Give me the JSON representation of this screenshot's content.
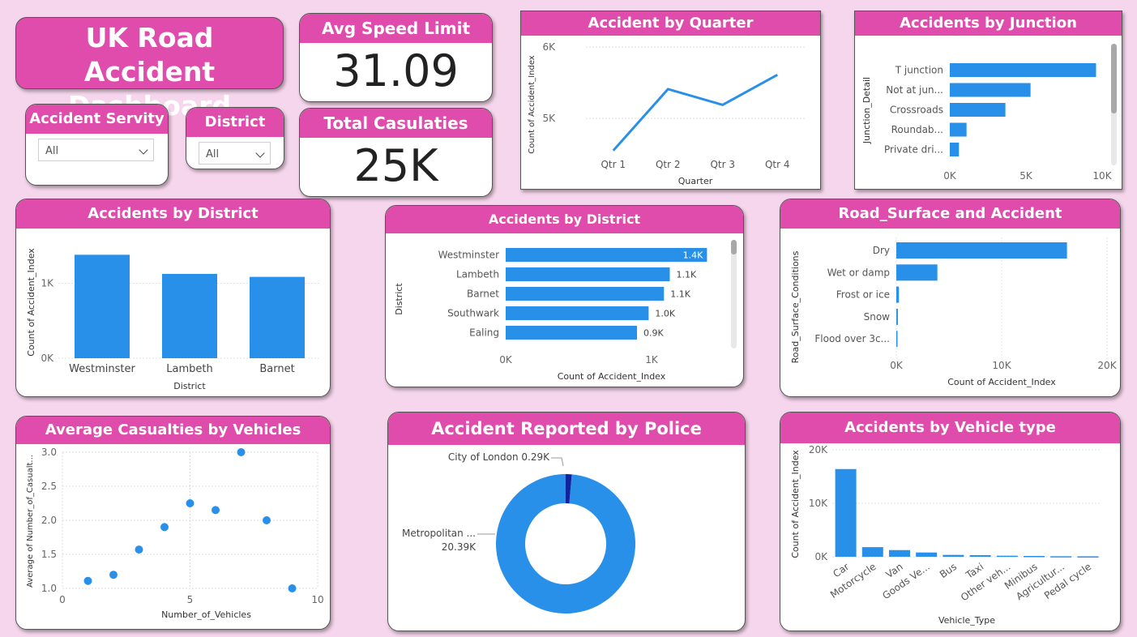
{
  "colors": {
    "accent": "#e04cac",
    "bar": "#2990ea",
    "dark_slice": "#12239e",
    "background": "#f6d6ec"
  },
  "dashboard_title": "UK Road Accident Dashboard",
  "kpis": {
    "speed": {
      "title": "Avg Speed Limit",
      "value": "31.09"
    },
    "casualties": {
      "title": "Total Casulaties",
      "value": "25K"
    }
  },
  "slicers": {
    "severity": {
      "title": "Accident Servity",
      "value": "All"
    },
    "district": {
      "title": "District",
      "value": "All"
    }
  },
  "chart_data": [
    {
      "id": "quarter",
      "type": "line",
      "title": "Accident by Quarter",
      "xlabel": "Quarter",
      "ylabel": "Count of Accident_Index",
      "categories": [
        "Qtr 1",
        "Qtr 2",
        "Qtr 3",
        "Qtr 4"
      ],
      "values": [
        4550,
        5410,
        5190,
        5610
      ],
      "ylim": [
        4400,
        6000
      ],
      "yticks": [
        {
          "v": 5000,
          "label": "5K"
        },
        {
          "v": 6000,
          "label": "6K"
        }
      ],
      "grid": true
    },
    {
      "id": "junction",
      "type": "bar",
      "orientation": "horizontal",
      "title": "Accidents by Junction",
      "xlabel": "Count of Accident_Index",
      "ylabel": "Junction_Detail",
      "categories": [
        "T junction",
        "Not at jun...",
        "Crossroads",
        "Roundab...",
        "Private dri..."
      ],
      "values": [
        9600,
        5300,
        3650,
        1100,
        600
      ],
      "xlim": [
        0,
        10000
      ],
      "xticks": [
        {
          "v": 0,
          "label": "0K"
        },
        {
          "v": 5000,
          "label": "5K"
        },
        {
          "v": 10000,
          "label": "10K"
        }
      ]
    },
    {
      "id": "district_col",
      "type": "bar",
      "orientation": "vertical",
      "title": "Accidents by District",
      "xlabel": "District",
      "ylabel": "Count of Accident_Index",
      "categories": [
        "Westminster",
        "Lambeth",
        "Barnet"
      ],
      "values": [
        1380,
        1125,
        1085
      ],
      "ylim": [
        0,
        1600
      ],
      "yticks": [
        {
          "v": 0,
          "label": "0K"
        },
        {
          "v": 1000,
          "label": "1K"
        }
      ]
    },
    {
      "id": "district_bar",
      "type": "bar",
      "orientation": "horizontal",
      "title": "Accidents by District",
      "xlabel": "Count of Accident_Index",
      "ylabel": "District",
      "categories": [
        "Westminster",
        "Lambeth",
        "Barnet",
        "Southwark",
        "Ealing"
      ],
      "values": [
        1380,
        1125,
        1085,
        980,
        900
      ],
      "data_labels": [
        "1.4K",
        "1.1K",
        "1.1K",
        "1.0K",
        "0.9K"
      ],
      "xlim": [
        0,
        1450
      ],
      "xticks": [
        {
          "v": 0,
          "label": "0K"
        },
        {
          "v": 1000,
          "label": "1K"
        }
      ]
    },
    {
      "id": "surface",
      "type": "bar",
      "orientation": "horizontal",
      "title": "Road_Surface and Accident",
      "xlabel": "Count of Accident_Index",
      "ylabel": "Road_Surface_Conditions",
      "categories": [
        "Dry",
        "Wet or damp",
        "Frost or ice",
        "Snow",
        "Flood over 3c..."
      ],
      "values": [
        16200,
        3900,
        250,
        150,
        60
      ],
      "xlim": [
        0,
        20000
      ],
      "xticks": [
        {
          "v": 0,
          "label": "0K"
        },
        {
          "v": 10000,
          "label": "10K"
        },
        {
          "v": 20000,
          "label": "20K"
        }
      ]
    },
    {
      "id": "scatter",
      "type": "scatter",
      "title": "Average Casualties by Vehicles",
      "xlabel": "Number_of_Vehicles",
      "ylabel": "Average of Number_of_Casualt...",
      "x": [
        1,
        2,
        3,
        4,
        5,
        6,
        7,
        8,
        9
      ],
      "y": [
        1.11,
        1.2,
        1.57,
        1.9,
        2.25,
        2.15,
        3.0,
        2.0,
        1.0
      ],
      "xlim": [
        0,
        10
      ],
      "ylim": [
        1.0,
        3.0
      ],
      "xticks": [
        {
          "v": 0,
          "label": "0"
        },
        {
          "v": 5,
          "label": "5"
        },
        {
          "v": 10,
          "label": "10"
        }
      ],
      "yticks": [
        {
          "v": 1.0,
          "label": "1.0"
        },
        {
          "v": 1.5,
          "label": "1.5"
        },
        {
          "v": 2.0,
          "label": "2.0"
        },
        {
          "v": 2.5,
          "label": "2.5"
        },
        {
          "v": 3.0,
          "label": "3.0"
        }
      ],
      "grid": true
    },
    {
      "id": "police",
      "type": "pie",
      "title": "Accident Reported by Police",
      "slices": [
        {
          "label": "Metropolitan ...",
          "value_label": "20.39K",
          "value": 20390
        },
        {
          "label": "City of London",
          "value_label": "0.29K",
          "value": 290
        }
      ]
    },
    {
      "id": "vehicle",
      "type": "bar",
      "orientation": "vertical",
      "title": "Accidents by Vehicle type",
      "xlabel": "Vehicle_Type",
      "ylabel": "Count of Accident_Index",
      "categories": [
        "Car",
        "Motorcycle",
        "Van",
        "Goods Ve...",
        "Bus",
        "Taxi",
        "Other veh...",
        "Minibus",
        "Agricultur...",
        "Pedal cycle"
      ],
      "values": [
        16400,
        1800,
        1250,
        800,
        350,
        300,
        200,
        150,
        100,
        80
      ],
      "ylim": [
        0,
        20000
      ],
      "yticks": [
        {
          "v": 0,
          "label": "0K"
        },
        {
          "v": 10000,
          "label": "10K"
        },
        {
          "v": 20000,
          "label": "20K"
        }
      ]
    }
  ]
}
